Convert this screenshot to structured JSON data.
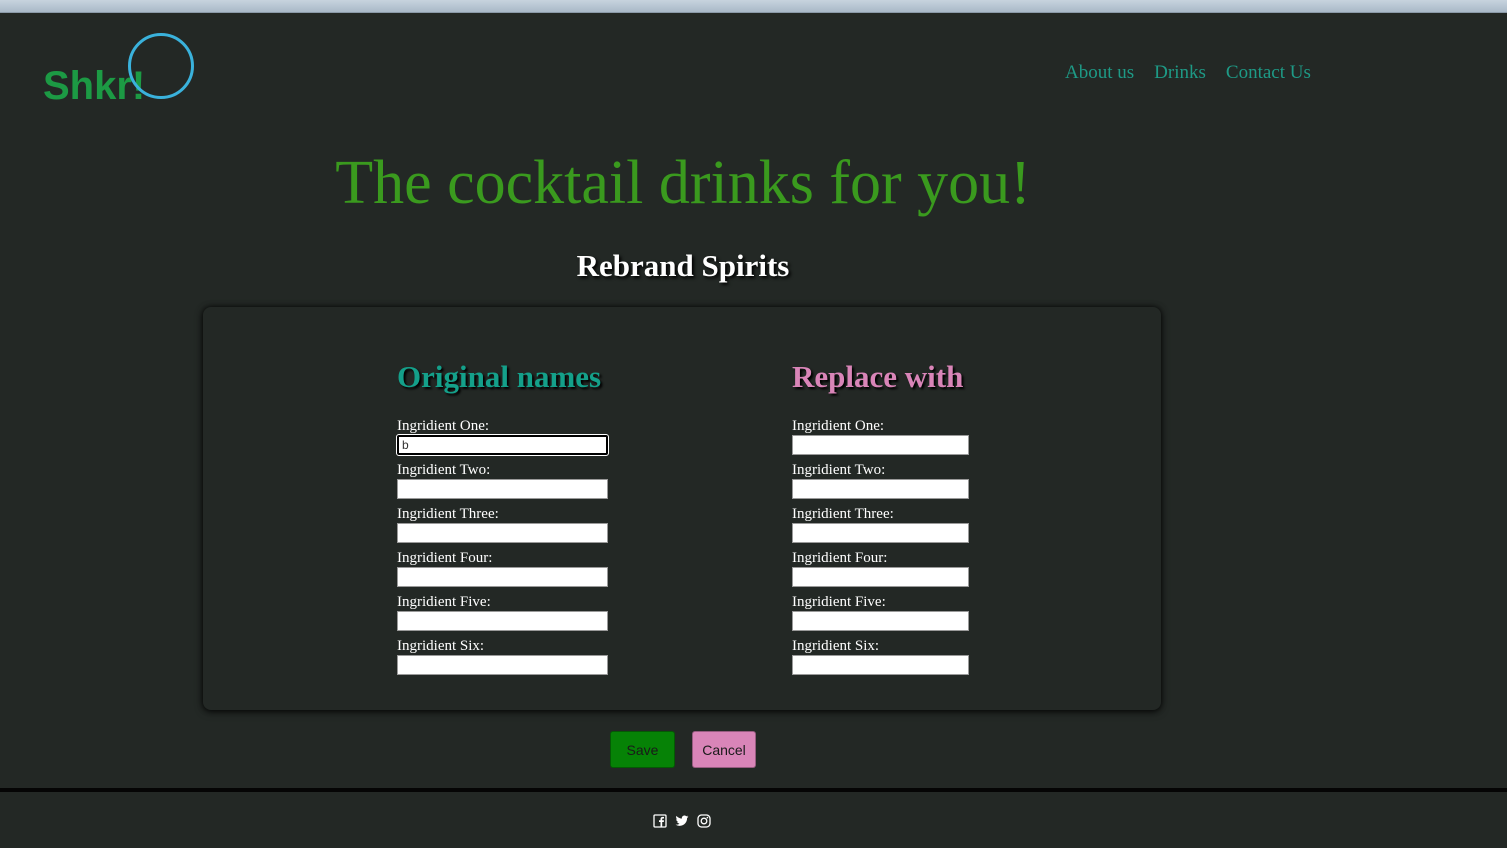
{
  "brand": {
    "logo_text": "Shkr!",
    "logo_color": "#1c9a44",
    "ring_color": "#3ab2dc"
  },
  "nav": {
    "items": [
      {
        "label": "About us"
      },
      {
        "label": "Drinks"
      },
      {
        "label": "Contact Us"
      }
    ]
  },
  "hero": {
    "title": "The cocktail drinks for you!"
  },
  "page": {
    "subtitle": "Rebrand Spirits"
  },
  "form": {
    "original": {
      "heading": "Original names",
      "fields": [
        {
          "label": "Ingridient One:",
          "value": "b"
        },
        {
          "label": "Ingridient Two:",
          "value": ""
        },
        {
          "label": "Ingridient Three:",
          "value": ""
        },
        {
          "label": "Ingridient Four:",
          "value": ""
        },
        {
          "label": "Ingridient Five:",
          "value": ""
        },
        {
          "label": "Ingridient Six:",
          "value": ""
        }
      ]
    },
    "replace": {
      "heading": "Replace with",
      "fields": [
        {
          "label": "Ingridient One:",
          "value": ""
        },
        {
          "label": "Ingridient Two:",
          "value": ""
        },
        {
          "label": "Ingridient Three:",
          "value": ""
        },
        {
          "label": "Ingridient Four:",
          "value": ""
        },
        {
          "label": "Ingridient Five:",
          "value": ""
        },
        {
          "label": "Ingridient Six:",
          "value": ""
        }
      ]
    },
    "save_label": "Save",
    "cancel_label": "Cancel"
  },
  "footer": {
    "social_icons": [
      "facebook-icon",
      "twitter-icon",
      "instagram-icon"
    ]
  },
  "colors": {
    "background": "#232825",
    "nav_link": "#1e9a86",
    "hero_title": "#3a9a1e",
    "original_heading": "#14a08a",
    "replace_heading": "#d985b8",
    "save_button": "#068206",
    "cancel_button": "#d985b8"
  }
}
